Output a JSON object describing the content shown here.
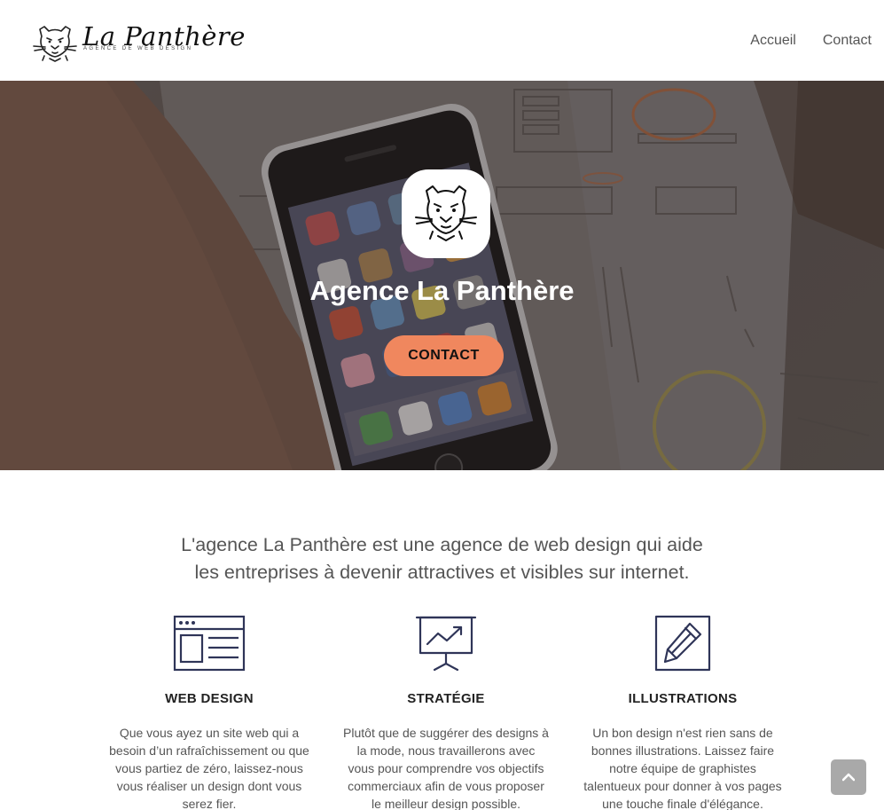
{
  "header": {
    "logo_text": "La Panthère",
    "logo_tagline": "AGENCE DE WEB DESIGN",
    "nav": [
      {
        "label": "Accueil"
      },
      {
        "label": "Contact"
      }
    ]
  },
  "hero": {
    "title": "Agence La Panthère",
    "cta_label": "CONTACT"
  },
  "intro": {
    "line1": "L'agence La Panthère est une agence de web design qui aide",
    "line2": "les entreprises à devenir attractives et visibles sur internet."
  },
  "services": [
    {
      "icon": "web-layout-icon",
      "title": "WEB DESIGN",
      "text": "Que vous ayez un site web qui a besoin d’un rafraîchissement ou que vous partiez de zéro, laissez-nous vous réaliser un design dont vous serez fier."
    },
    {
      "icon": "presentation-chart-icon",
      "title": "STRATÉGIE",
      "text": "Plutôt que de suggérer des designs à la mode, nous travaillerons avec vous pour comprendre vos objectifs commerciaux afin de vous proposer le meilleur design possible."
    },
    {
      "icon": "pencil-icon",
      "title": "ILLUSTRATIONS",
      "text": "Un bon design n'est rien sans de bonnes illustrations. Laissez faire notre équipe de graphistes talentueux pour donner à vos pages une touche finale d'élégance."
    }
  ],
  "colors": {
    "accent": "#f0875e",
    "icon_stroke": "#2f3558",
    "scroll_button": "#a9a9a9"
  }
}
